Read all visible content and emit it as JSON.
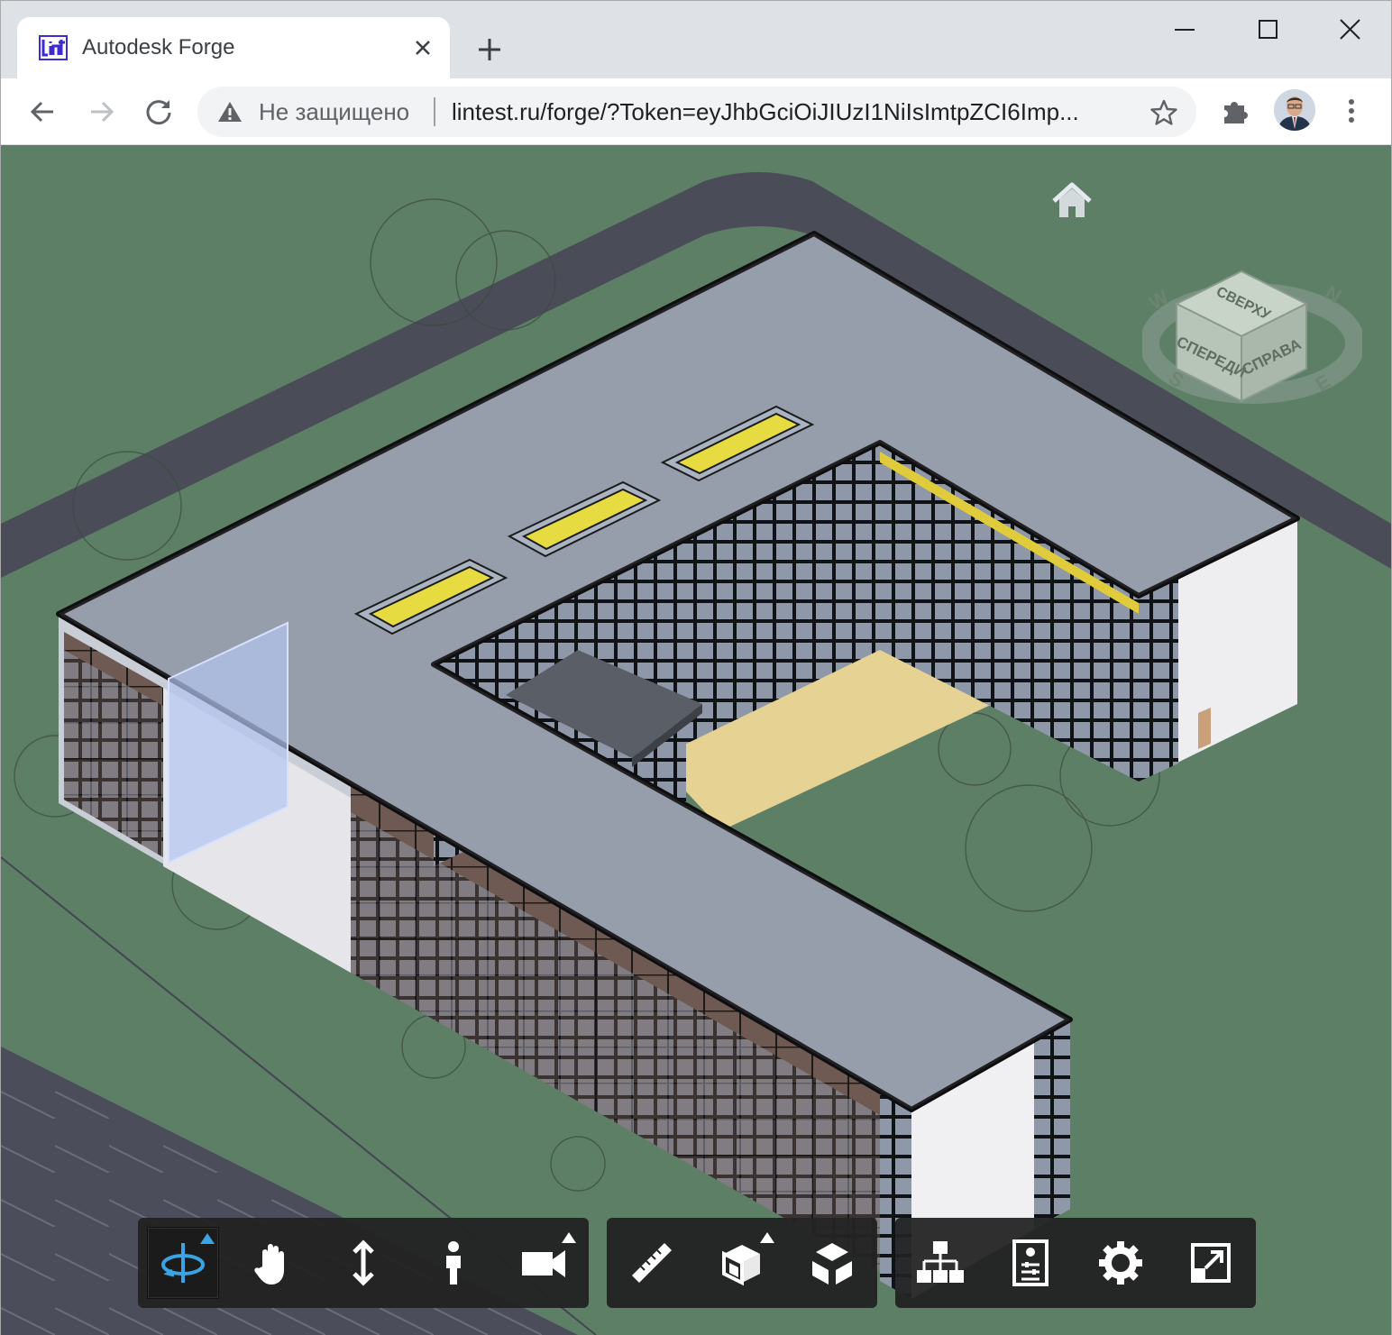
{
  "browser": {
    "tab": {
      "title": "Autodesk Forge",
      "favicon": "lint-logo",
      "close_icon": "close-icon"
    },
    "new_tab_icon": "plus-icon",
    "window_controls": [
      "minimize-icon",
      "maximize-icon",
      "close-icon"
    ],
    "nav": [
      "back-icon",
      "forward-icon",
      "reload-icon"
    ],
    "address_bar": {
      "security_icon": "warning-icon",
      "security_text": "Не защищено",
      "url": "lintest.ru/forge/?Token=eyJhbGciOiJIUzI1NiIsImtpZCI6Imp..."
    },
    "bookmark_icon": "star-icon",
    "extensions_icon": "puzzle-icon",
    "menu_icon": "kebab-menu-icon",
    "colors": {
      "tabstrip": "#dee1e6",
      "omnibox": "#f1f3f4",
      "accent": "#1a73e8"
    }
  },
  "viewer": {
    "home_icon": "home-icon",
    "viewcube": {
      "faces": {
        "top": "СВЕРХУ",
        "front": "СПЕРЕДИ",
        "right": "СПРАВА"
      },
      "compass": {
        "n": "N",
        "s": "S",
        "e": "E",
        "w": "W"
      }
    },
    "colors": {
      "ground": "#5d7f66",
      "road": "#4a4c58",
      "roof": "#8e95a4",
      "courtyard": "#e6d394",
      "glass_panel": "#b4c4f0"
    },
    "toolbar": {
      "groups": [
        [
          {
            "name": "orbit",
            "icon": "orbit-icon",
            "active": true,
            "flyout": true
          },
          {
            "name": "pan",
            "icon": "hand-icon",
            "active": false,
            "flyout": false
          },
          {
            "name": "zoom",
            "icon": "zoom-arrows-icon",
            "active": false,
            "flyout": false
          },
          {
            "name": "first-person",
            "icon": "person-icon",
            "active": false,
            "flyout": false
          },
          {
            "name": "camera",
            "icon": "camera-icon",
            "active": false,
            "flyout": true
          }
        ],
        [
          {
            "name": "measure",
            "icon": "ruler-icon",
            "active": false,
            "flyout": false
          },
          {
            "name": "section",
            "icon": "section-box-icon",
            "active": false,
            "flyout": true
          },
          {
            "name": "explode",
            "icon": "explode-cube-icon",
            "active": false,
            "flyout": false
          }
        ],
        [
          {
            "name": "model-browser",
            "icon": "hierarchy-icon",
            "active": false,
            "flyout": false
          },
          {
            "name": "properties",
            "icon": "properties-icon",
            "active": false,
            "flyout": false
          },
          {
            "name": "settings",
            "icon": "gear-icon",
            "active": false,
            "flyout": false
          },
          {
            "name": "fullscreen",
            "icon": "fullscreen-icon",
            "active": false,
            "flyout": false
          }
        ]
      ]
    }
  }
}
